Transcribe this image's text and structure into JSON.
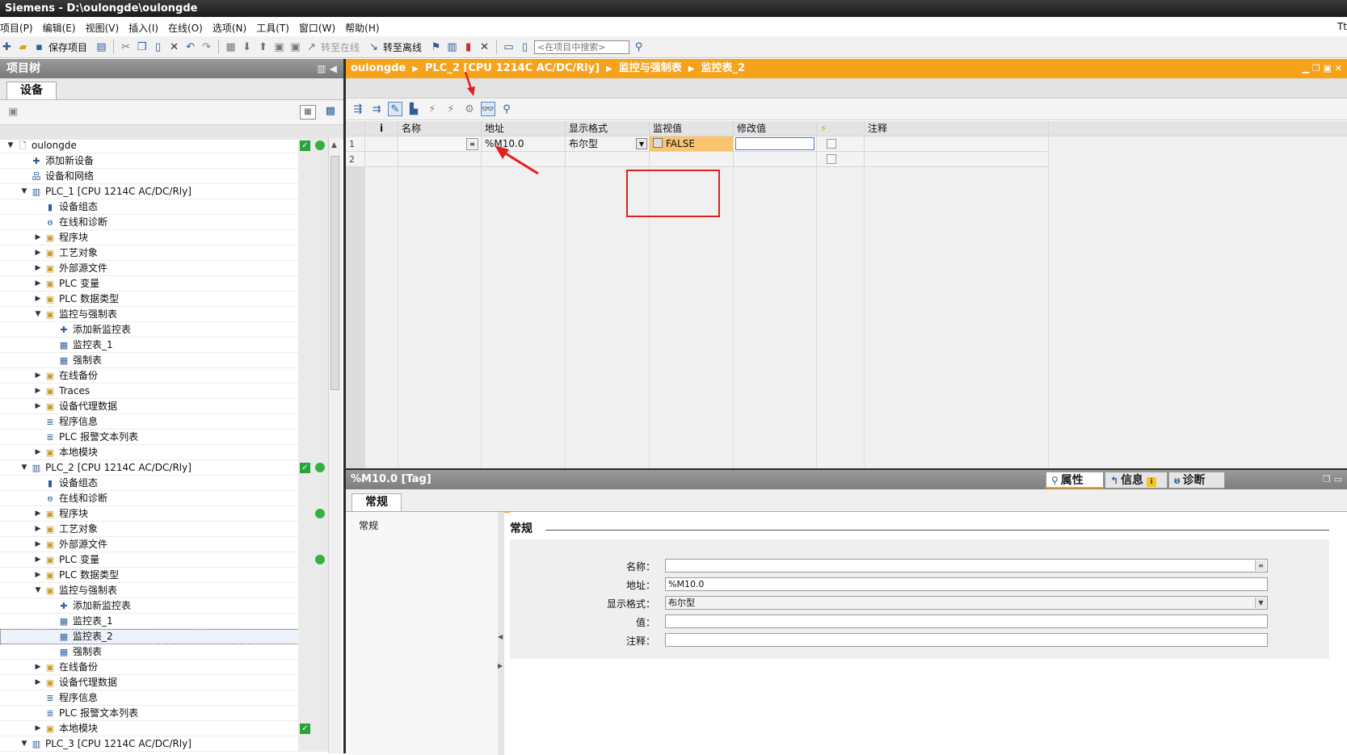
{
  "window": {
    "title": "Siemens  -  D:\\oulongde\\oulongde",
    "right_edge_text": "Tt"
  },
  "menu": [
    "项目(P)",
    "编辑(E)",
    "视图(V)",
    "插入(I)",
    "在线(O)",
    "选项(N)",
    "工具(T)",
    "窗口(W)",
    "帮助(H)"
  ],
  "toolbar": {
    "save_label": "保存项目",
    "go_online_label": "转至在线",
    "go_offline_label": "转至离线",
    "search_placeholder": "<在项目中搜索>"
  },
  "project_tree": {
    "header_title": "项目树",
    "tab_devices": "设备",
    "rows": [
      {
        "label": "oulongde",
        "level": 0,
        "toggle": "▼",
        "icon": "project-icon",
        "glyph": "🗋",
        "check": true,
        "dot": true
      },
      {
        "label": "添加新设备",
        "level": 1,
        "toggle": "",
        "icon": "add-device-icon",
        "glyph": "✚"
      },
      {
        "label": "设备和网络",
        "level": 1,
        "toggle": "",
        "icon": "network-icon",
        "glyph": "品"
      },
      {
        "label": "PLC_1 [CPU 1214C AC/DC/Rly]",
        "level": 1,
        "toggle": "▼",
        "icon": "plc-icon",
        "glyph": "▥"
      },
      {
        "label": "设备组态",
        "level": 2,
        "toggle": "",
        "icon": "device-config-icon",
        "glyph": "▮"
      },
      {
        "label": "在线和诊断",
        "level": 2,
        "toggle": "",
        "icon": "diagnostics-icon",
        "glyph": "ᵿ"
      },
      {
        "label": "程序块",
        "level": 2,
        "toggle": "▶",
        "icon": "folder-icon",
        "glyph": "▣"
      },
      {
        "label": "工艺对象",
        "level": 2,
        "toggle": "▶",
        "icon": "folder-icon",
        "glyph": "▣"
      },
      {
        "label": "外部源文件",
        "level": 2,
        "toggle": "▶",
        "icon": "folder-icon",
        "glyph": "▣"
      },
      {
        "label": "PLC 变量",
        "level": 2,
        "toggle": "▶",
        "icon": "folder-icon",
        "glyph": "▣"
      },
      {
        "label": "PLC 数据类型",
        "level": 2,
        "toggle": "▶",
        "icon": "folder-icon",
        "glyph": "▣"
      },
      {
        "label": "监控与强制表",
        "level": 2,
        "toggle": "▼",
        "icon": "folder-icon",
        "glyph": "▣"
      },
      {
        "label": "添加新监控表",
        "level": 3,
        "toggle": "",
        "icon": "add-watch-table-icon",
        "glyph": "✚"
      },
      {
        "label": "监控表_1",
        "level": 3,
        "toggle": "",
        "icon": "watch-table-icon",
        "glyph": "▦"
      },
      {
        "label": "强制表",
        "level": 3,
        "toggle": "",
        "icon": "force-table-icon",
        "glyph": "▦"
      },
      {
        "label": "在线备份",
        "level": 2,
        "toggle": "▶",
        "icon": "folder-icon",
        "glyph": "▣"
      },
      {
        "label": "Traces",
        "level": 2,
        "toggle": "▶",
        "icon": "folder-icon",
        "glyph": "▣"
      },
      {
        "label": "设备代理数据",
        "level": 2,
        "toggle": "▶",
        "icon": "folder-icon",
        "glyph": "▣"
      },
      {
        "label": "程序信息",
        "level": 2,
        "toggle": "",
        "icon": "program-info-icon",
        "glyph": "≣"
      },
      {
        "label": "PLC 报警文本列表",
        "level": 2,
        "toggle": "",
        "icon": "alarm-text-icon",
        "glyph": "≣"
      },
      {
        "label": "本地模块",
        "level": 2,
        "toggle": "▶",
        "icon": "folder-icon",
        "glyph": "▣"
      },
      {
        "label": "PLC_2 [CPU 1214C AC/DC/Rly]",
        "level": 1,
        "toggle": "▼",
        "icon": "plc-icon",
        "glyph": "▥",
        "check": true,
        "dot": true
      },
      {
        "label": "设备组态",
        "level": 2,
        "toggle": "",
        "icon": "device-config-icon",
        "glyph": "▮"
      },
      {
        "label": "在线和诊断",
        "level": 2,
        "toggle": "",
        "icon": "diagnostics-icon",
        "glyph": "ᵿ"
      },
      {
        "label": "程序块",
        "level": 2,
        "toggle": "▶",
        "icon": "folder-icon",
        "glyph": "▣",
        "dot": true
      },
      {
        "label": "工艺对象",
        "level": 2,
        "toggle": "▶",
        "icon": "folder-icon",
        "glyph": "▣"
      },
      {
        "label": "外部源文件",
        "level": 2,
        "toggle": "▶",
        "icon": "folder-icon",
        "glyph": "▣"
      },
      {
        "label": "PLC 变量",
        "level": 2,
        "toggle": "▶",
        "icon": "folder-icon",
        "glyph": "▣",
        "dot": true
      },
      {
        "label": "PLC 数据类型",
        "level": 2,
        "toggle": "▶",
        "icon": "folder-icon",
        "glyph": "▣"
      },
      {
        "label": "监控与强制表",
        "level": 2,
        "toggle": "▼",
        "icon": "folder-icon",
        "glyph": "▣"
      },
      {
        "label": "添加新监控表",
        "level": 3,
        "toggle": "",
        "icon": "add-watch-table-icon",
        "glyph": "✚"
      },
      {
        "label": "监控表_1",
        "level": 3,
        "toggle": "",
        "icon": "watch-table-icon",
        "glyph": "▦"
      },
      {
        "label": "监控表_2",
        "level": 3,
        "toggle": "",
        "icon": "watch-table-icon",
        "glyph": "▦",
        "selected": true
      },
      {
        "label": "强制表",
        "level": 3,
        "toggle": "",
        "icon": "force-table-icon",
        "glyph": "▦"
      },
      {
        "label": "在线备份",
        "level": 2,
        "toggle": "▶",
        "icon": "folder-icon",
        "glyph": "▣"
      },
      {
        "label": "设备代理数据",
        "level": 2,
        "toggle": "▶",
        "icon": "folder-icon",
        "glyph": "▣"
      },
      {
        "label": "程序信息",
        "level": 2,
        "toggle": "",
        "icon": "program-info-icon",
        "glyph": "≣"
      },
      {
        "label": "PLC 报警文本列表",
        "level": 2,
        "toggle": "",
        "icon": "alarm-text-icon",
        "glyph": "≣"
      },
      {
        "label": "本地模块",
        "level": 2,
        "toggle": "▶",
        "icon": "folder-icon",
        "glyph": "▣",
        "check": true
      },
      {
        "label": "PLC_3 [CPU 1214C AC/DC/Rly]",
        "level": 1,
        "toggle": "▼",
        "icon": "plc-icon",
        "glyph": "▥"
      }
    ]
  },
  "breadcrumb": [
    "oulongde",
    "PLC_2 [CPU 1214C AC/DC/Rly]",
    "监控与强制表",
    "监控表_2"
  ],
  "watch_table": {
    "columns": [
      "i",
      "名称",
      "地址",
      "显示格式",
      "监视值",
      "修改值",
      "⚡",
      "注释"
    ],
    "rows": [
      {
        "num": "1",
        "name": "",
        "address": "%M10.0",
        "format": "布尔型",
        "monitor": "FALSE",
        "modify": "",
        "comment": ""
      },
      {
        "num": "2",
        "name": "",
        "address": "",
        "format": "",
        "monitor": "",
        "modify": "",
        "comment": ""
      }
    ]
  },
  "properties": {
    "header_title": "%M10.0 [Tag]",
    "tab_properties": "属性",
    "tab_info": "信息",
    "tab_diagnostics": "诊断",
    "subtab_general": "常规",
    "nav_general": "常规",
    "section_title": "常规",
    "fields": {
      "name_label": "名称：",
      "name_value": "",
      "address_label": "地址：",
      "address_value": "%M10.0",
      "format_label": "显示格式：",
      "format_value": "布尔型",
      "value_label": "值：",
      "value_value": "",
      "comment_label": "注释：",
      "comment_value": ""
    }
  },
  "colors": {
    "accent_orange": "#f7a21b",
    "monitor_false": "#f9c46d",
    "annotation_red": "#e02020"
  }
}
